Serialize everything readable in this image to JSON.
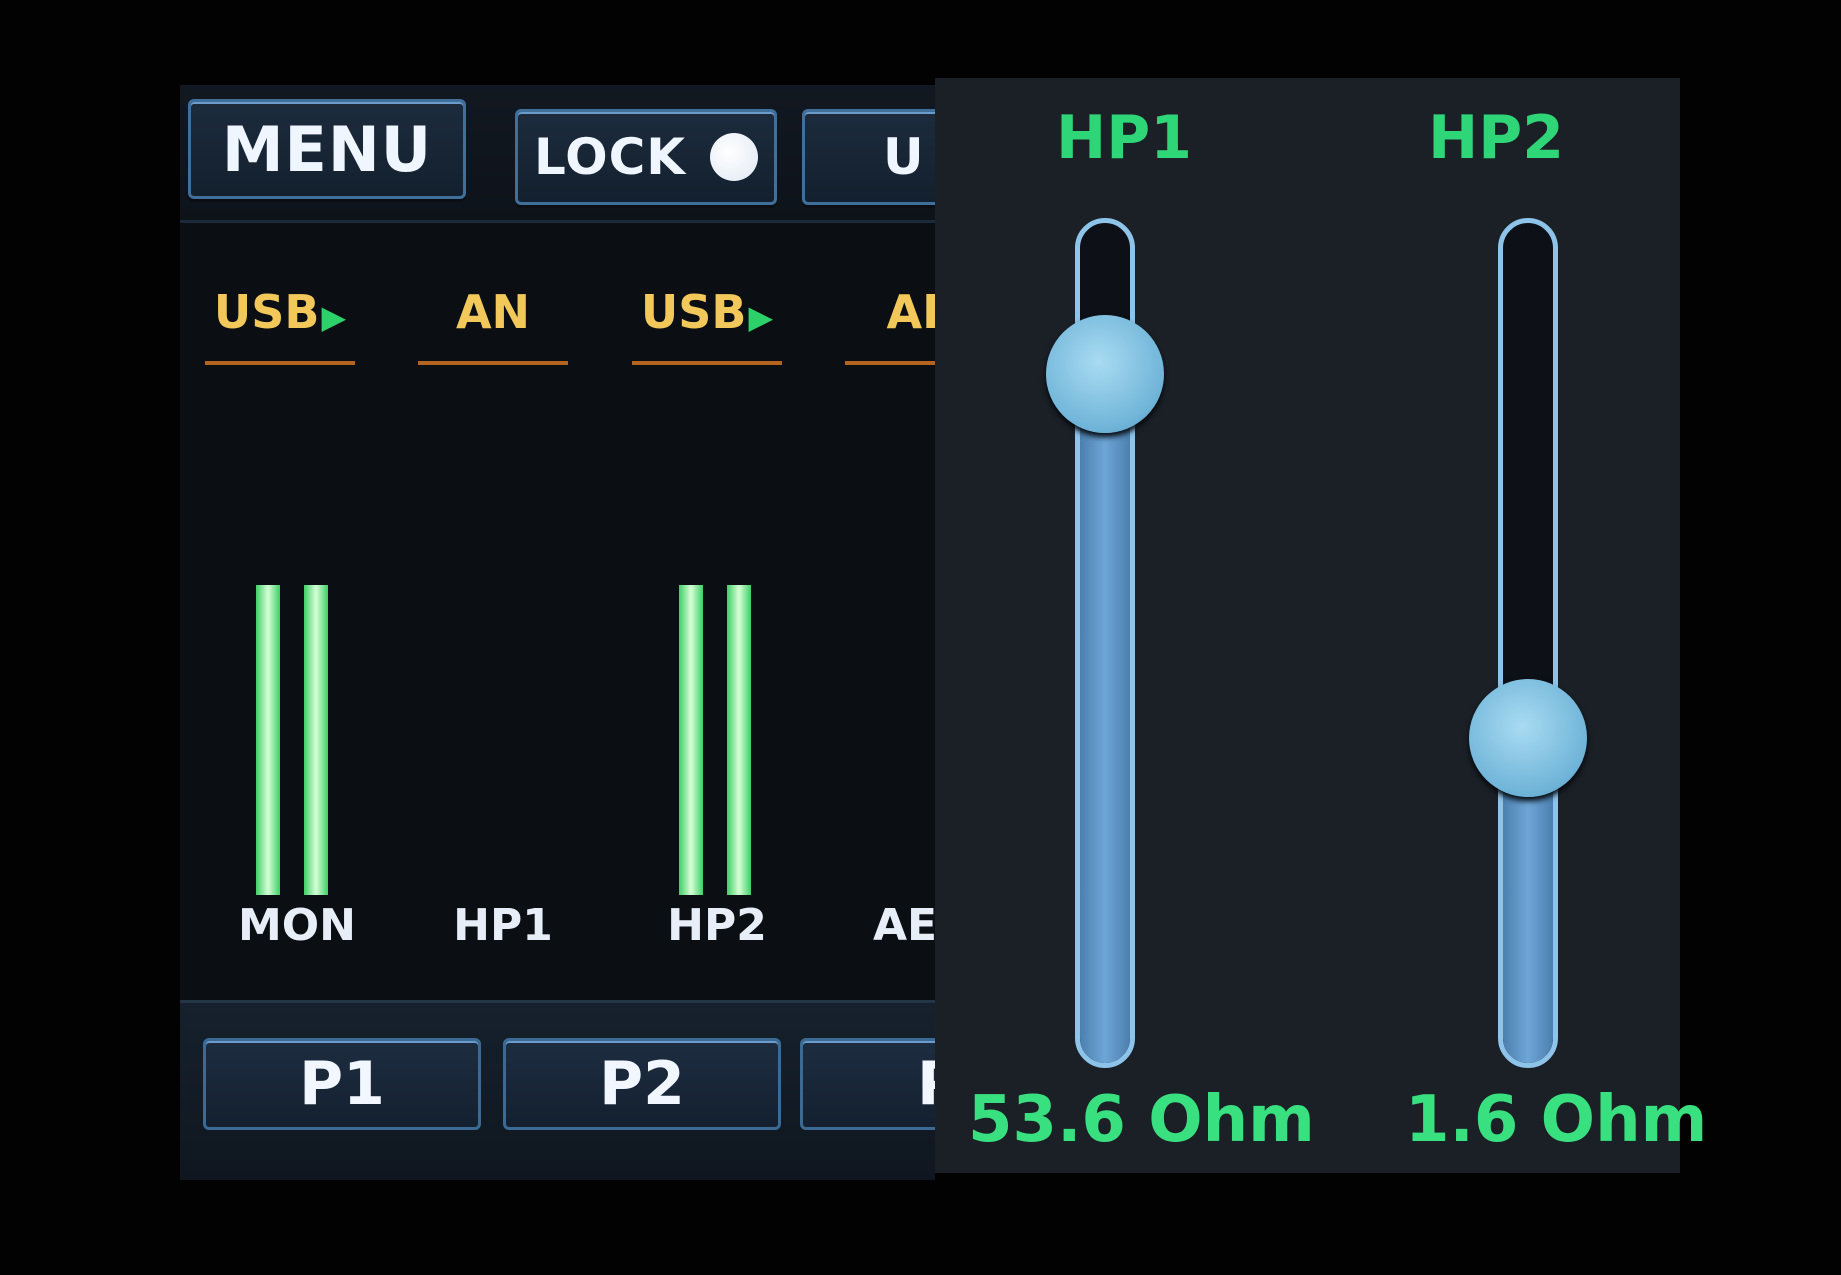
{
  "toolbar": {
    "menu_label": "MENU",
    "lock_label": "LOCK",
    "us_label": "U"
  },
  "sources": [
    {
      "label": "USB",
      "arrow": "▶"
    },
    {
      "label": "AN",
      "arrow": ""
    },
    {
      "label": "USB",
      "arrow": "▶"
    },
    {
      "label": "AE",
      "arrow": ""
    }
  ],
  "channels": [
    {
      "label": "MON"
    },
    {
      "label": "HP1"
    },
    {
      "label": "HP2"
    },
    {
      "label": "AE"
    }
  ],
  "presets": [
    {
      "label": "P1"
    },
    {
      "label": "P2"
    },
    {
      "label": "P"
    }
  ],
  "headphones": [
    {
      "title": "HP1",
      "value": "53.6 Ohm",
      "level": 0.84
    },
    {
      "title": "HP2",
      "value": "1.6 Ohm",
      "level": 0.38
    }
  ],
  "colors": {
    "accent_green": "#2fd678",
    "source_yellow": "#f3c85a",
    "slider_blue": "#6ea6d8"
  }
}
